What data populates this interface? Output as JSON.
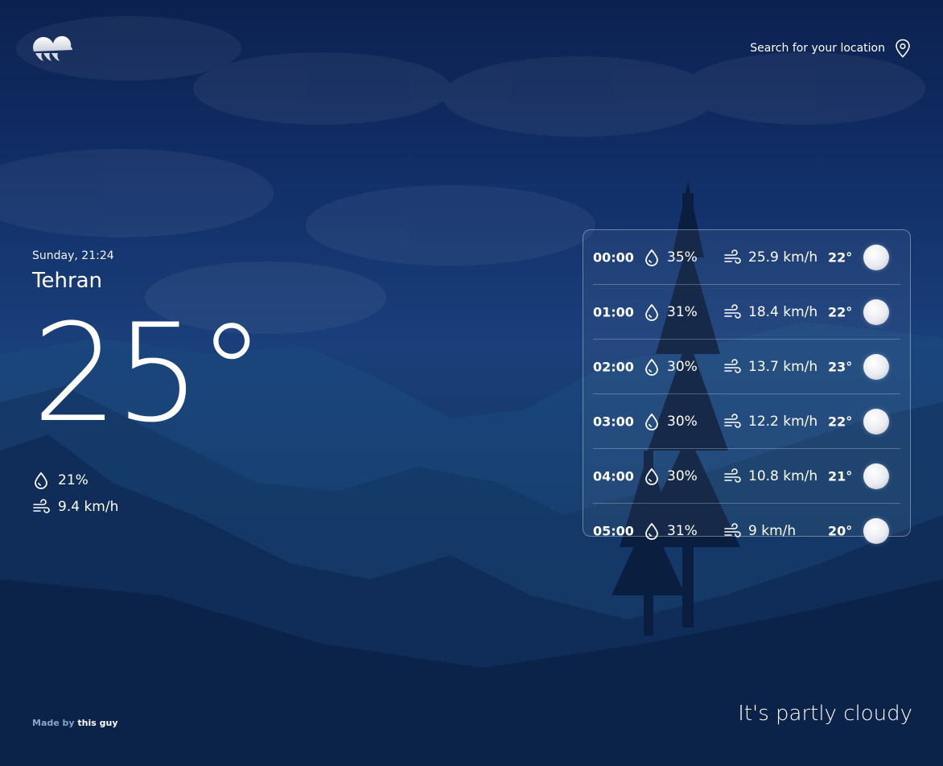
{
  "header": {
    "search_label": "Search for your location",
    "logo_icon": "cloud-logo-icon",
    "pin_icon": "map-pin-icon"
  },
  "current": {
    "datetime": "Sunday, 21:24",
    "city": "Tehran",
    "temperature": "25°",
    "humidity": "21%",
    "wind": "9.4 km/h",
    "humidity_icon": "droplet-icon",
    "wind_icon": "wind-icon"
  },
  "forecast": [
    {
      "time": "00:00",
      "humidity": "35%",
      "wind": "25.9 km/h",
      "temp": "22°",
      "icon": "moon-icon"
    },
    {
      "time": "01:00",
      "humidity": "31%",
      "wind": "18.4 km/h",
      "temp": "22°",
      "icon": "moon-icon"
    },
    {
      "time": "02:00",
      "humidity": "30%",
      "wind": "13.7 km/h",
      "temp": "23°",
      "icon": "moon-icon"
    },
    {
      "time": "03:00",
      "humidity": "30%",
      "wind": "12.2 km/h",
      "temp": "22°",
      "icon": "moon-icon"
    },
    {
      "time": "04:00",
      "humidity": "30%",
      "wind": "10.8 km/h",
      "temp": "21°",
      "icon": "moon-icon"
    },
    {
      "time": "05:00",
      "humidity": "31%",
      "wind": "9 km/h",
      "temp": "20°",
      "icon": "moon-icon"
    }
  ],
  "footer": {
    "made_by": "Made by",
    "author_link": "this guy",
    "condition": "It's partly cloudy"
  },
  "colors": {
    "background_top": "#0c2150",
    "background_mid": "#1a3f7a",
    "background_bottom": "#0b2146",
    "text": "#ffffff",
    "credit_muted": "#8ea3c8"
  }
}
